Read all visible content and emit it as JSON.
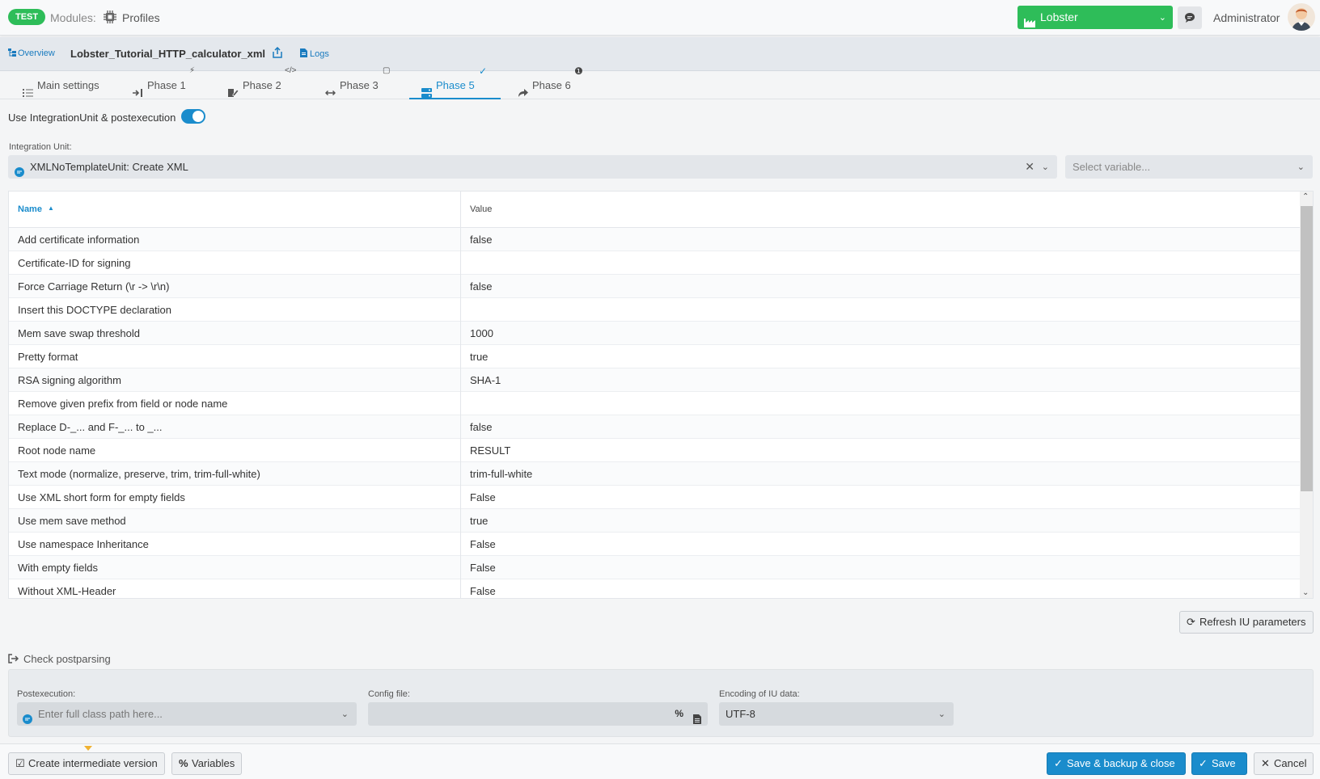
{
  "topbar": {
    "env_badge": "TEST",
    "modules_label": "Modules:",
    "modules_value": "Profiles",
    "client": "Lobster",
    "user": "Administrator"
  },
  "subbar": {
    "overview": "Overview",
    "profile_name": "Lobster_Tutorial_HTTP_calculator_xml",
    "logs": "Logs"
  },
  "tabs": [
    {
      "label": "Main settings",
      "icon": "list-icon"
    },
    {
      "label": "Phase 1",
      "icon": "sign-in-icon",
      "sup": "⚡"
    },
    {
      "label": "Phase 2",
      "icon": "edit-icon",
      "sup": "</>"
    },
    {
      "label": "Phase 3",
      "icon": "arrows-h-icon",
      "sup": "▢"
    },
    {
      "label": "Phase 5",
      "icon": "server-icon",
      "sup": "✓",
      "active": true
    },
    {
      "label": "Phase 6",
      "icon": "share-icon",
      "sup": "❶"
    }
  ],
  "integration": {
    "toggle_label": "Use IntegrationUnit & postexecution",
    "toggle_on": true,
    "unit_label": "Integration Unit:",
    "unit_value": "XMLNoTemplateUnit: Create XML",
    "variable_placeholder": "Select variable..."
  },
  "table": {
    "col_name": "Name",
    "col_value": "Value",
    "rows": [
      {
        "name": "Add certificate information",
        "value": "false"
      },
      {
        "name": "Certificate-ID for signing",
        "value": ""
      },
      {
        "name": "Force Carriage Return (\\r -> \\r\\n)",
        "value": "false"
      },
      {
        "name": "Insert this DOCTYPE declaration",
        "value": ""
      },
      {
        "name": "Mem save swap threshold",
        "value": "1000"
      },
      {
        "name": "Pretty format",
        "value": "true"
      },
      {
        "name": "RSA signing algorithm",
        "value": "SHA-1"
      },
      {
        "name": "Remove given prefix from field or node name",
        "value": ""
      },
      {
        "name": "Replace D-_... and F-_... to _...",
        "value": "false"
      },
      {
        "name": "Root node name",
        "value": "RESULT"
      },
      {
        "name": "Text mode (normalize, preserve, trim, trim-full-white)",
        "value": "trim-full-white"
      },
      {
        "name": "Use XML short form for empty fields",
        "value": "False"
      },
      {
        "name": "Use mem save method",
        "value": "true"
      },
      {
        "name": "Use namespace Inheritance",
        "value": "False"
      },
      {
        "name": "With empty fields",
        "value": "False"
      },
      {
        "name": "Without XML-Header",
        "value": "False"
      }
    ]
  },
  "refresh_label": "Refresh IU parameters",
  "postparsing": {
    "header": "Check postparsing",
    "postexec_label": "Postexecution:",
    "postexec_placeholder": "Enter full class path here...",
    "config_label": "Config file:",
    "config_value": "",
    "encoding_label": "Encoding of IU data:",
    "encoding_value": "UTF-8"
  },
  "footer": {
    "create_version": "Create intermediate version",
    "variables": "Variables",
    "save_backup_close": "Save & backup & close",
    "save": "Save",
    "cancel": "Cancel"
  },
  "colors": {
    "accent": "#1a8ccc",
    "green": "#2ebd59"
  }
}
